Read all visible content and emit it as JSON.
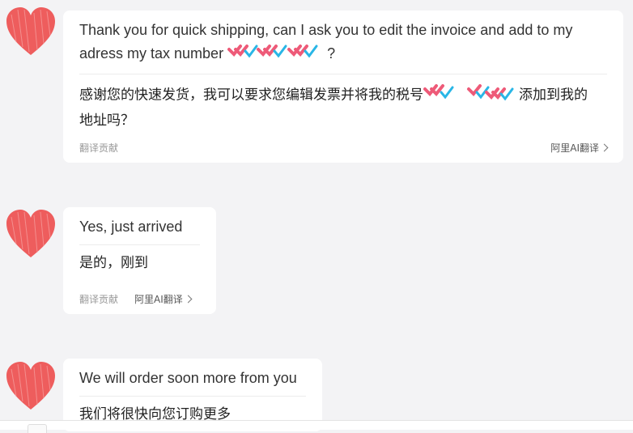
{
  "messages": [
    {
      "original": "Thank you for quick shipping, can I ask you to edit the invoice and add to my",
      "original_line2_prefix": "adress my tax number",
      "original_line2_suffix": "?",
      "translation_line1_prefix": "感谢您的快速发货，我可以要求您编辑发票并将我的税号",
      "translation_line1_suffix": "添加到我的",
      "translation_line2": "地址吗？",
      "contribute_label": "翻译贡献",
      "ali_translate_label": "阿里AI翻译"
    },
    {
      "original": "Yes, just arrived",
      "translation": "是的，刚到",
      "contribute_label": "翻译贡献",
      "ali_translate_label": "阿里AI翻译"
    },
    {
      "original": "We will order soon more from you",
      "translation": "我们将很快向您订购更多"
    }
  ],
  "colors": {
    "avatar_heart": "#ee5d5d",
    "redaction_pink": "#ee5a78",
    "redaction_cyan": "#29b6e6",
    "page_bg": "#f3f3f5",
    "bubble_bg": "#ffffff"
  },
  "icons": {
    "avatar": "heart-avatar",
    "chevron": "chevron-right-icon"
  }
}
